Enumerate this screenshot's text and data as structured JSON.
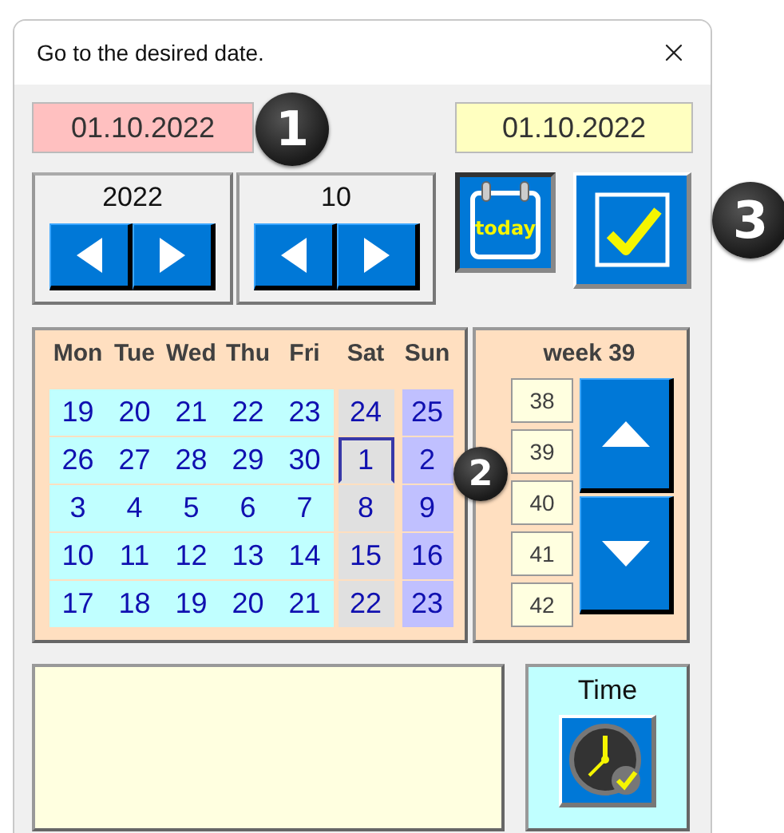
{
  "window": {
    "title": "Go to the desired date."
  },
  "selected_date": "01.10.2022",
  "current_date": "01.10.2022",
  "year": {
    "value": "2022"
  },
  "month": {
    "value": "10"
  },
  "today_button": {
    "label": "today"
  },
  "calendar": {
    "weekdays": [
      "Mon",
      "Tue",
      "Wed",
      "Thu",
      "Fri",
      "Sat",
      "Sun"
    ],
    "weeks": [
      {
        "days": [
          {
            "label": "19",
            "selected": false
          },
          {
            "label": "20",
            "selected": false
          },
          {
            "label": "21",
            "selected": false
          },
          {
            "label": "22",
            "selected": false
          },
          {
            "label": "23",
            "selected": false
          },
          {
            "label": "24",
            "selected": false
          },
          {
            "label": "25",
            "selected": false
          }
        ]
      },
      {
        "days": [
          {
            "label": "26",
            "selected": false
          },
          {
            "label": "27",
            "selected": false
          },
          {
            "label": "28",
            "selected": false
          },
          {
            "label": "29",
            "selected": false
          },
          {
            "label": "30",
            "selected": false
          },
          {
            "label": "1",
            "selected": true
          },
          {
            "label": "2",
            "selected": false
          }
        ]
      },
      {
        "days": [
          {
            "label": "3",
            "selected": false
          },
          {
            "label": "4",
            "selected": false
          },
          {
            "label": "5",
            "selected": false
          },
          {
            "label": "6",
            "selected": false
          },
          {
            "label": "7",
            "selected": false
          },
          {
            "label": "8",
            "selected": false
          },
          {
            "label": "9",
            "selected": false
          }
        ]
      },
      {
        "days": [
          {
            "label": "10",
            "selected": false
          },
          {
            "label": "11",
            "selected": false
          },
          {
            "label": "12",
            "selected": false
          },
          {
            "label": "13",
            "selected": false
          },
          {
            "label": "14",
            "selected": false
          },
          {
            "label": "15",
            "selected": false
          },
          {
            "label": "16",
            "selected": false
          }
        ]
      },
      {
        "days": [
          {
            "label": "17",
            "selected": false
          },
          {
            "label": "18",
            "selected": false
          },
          {
            "label": "19",
            "selected": false
          },
          {
            "label": "20",
            "selected": false
          },
          {
            "label": "21",
            "selected": false
          },
          {
            "label": "22",
            "selected": false
          },
          {
            "label": "23",
            "selected": false
          }
        ]
      }
    ]
  },
  "week_panel": {
    "title": "week 39",
    "weeks": [
      "38",
      "39",
      "40",
      "41",
      "42"
    ]
  },
  "time_panel": {
    "title": "Time"
  },
  "callouts": [
    "1",
    "2",
    "3"
  ]
}
